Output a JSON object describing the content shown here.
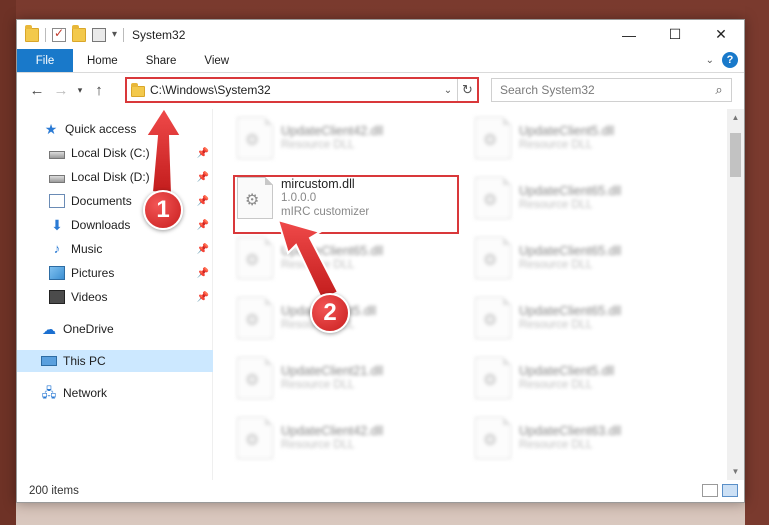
{
  "window": {
    "title": "System32",
    "controls": {
      "minimize": "—",
      "maximize": "☐",
      "close": "✕"
    }
  },
  "ribbon": {
    "tabs": [
      "File",
      "Home",
      "Share",
      "View"
    ],
    "help": "?"
  },
  "nav": {
    "address": "C:\\Windows\\System32",
    "search_placeholder": "Search System32"
  },
  "sidebar": {
    "items": [
      {
        "label": "Quick access",
        "icon": "star-icon",
        "pinned": false
      },
      {
        "label": "Local Disk (C:)",
        "icon": "disk-icon",
        "pinned": true
      },
      {
        "label": "Local Disk (D:)",
        "icon": "disk-icon",
        "pinned": true
      },
      {
        "label": "Documents",
        "icon": "documents-icon",
        "pinned": true
      },
      {
        "label": "Downloads",
        "icon": "download-icon",
        "pinned": true
      },
      {
        "label": "Music",
        "icon": "music-icon",
        "pinned": true
      },
      {
        "label": "Pictures",
        "icon": "pictures-icon",
        "pinned": true
      },
      {
        "label": "Videos",
        "icon": "videos-icon",
        "pinned": true
      },
      {
        "label": "OneDrive",
        "icon": "cloud-icon",
        "pinned": false
      },
      {
        "label": "This PC",
        "icon": "pc-icon",
        "pinned": false,
        "selected": true
      },
      {
        "label": "Network",
        "icon": "network-icon",
        "pinned": false
      }
    ]
  },
  "files": {
    "col1": [
      {
        "name": "UpdateClient42.dll",
        "type": "Resource DLL"
      },
      {
        "name": "mircustom.dll",
        "version": "1.0.0.0",
        "description": "mIRC customizer"
      },
      {
        "name": "UpdateClient65.dll",
        "type": "Resource DLL"
      },
      {
        "name": "UpdateClient5.dll",
        "type": "Resource DLL"
      },
      {
        "name": "UpdateClient21.dll",
        "type": "Resource DLL"
      },
      {
        "name": "UpdateClient42.dll",
        "type": "Resource DLL"
      }
    ],
    "col2": [
      {
        "name": "UpdateClient5.dll",
        "type": "Resource DLL"
      },
      {
        "name": "UpdateClient65.dll",
        "type": "Resource DLL"
      },
      {
        "name": "UpdateClient65.dll",
        "type": "Resource DLL"
      },
      {
        "name": "UpdateClient65.dll",
        "type": "Resource DLL"
      },
      {
        "name": "UpdateClient5.dll",
        "type": "Resource DLL"
      },
      {
        "name": "UpdateClient63.dll",
        "type": "Resource DLL"
      }
    ]
  },
  "status": {
    "count": "200 items"
  },
  "annotations": {
    "step1": "1",
    "step2": "2",
    "color": "#d9383a"
  }
}
